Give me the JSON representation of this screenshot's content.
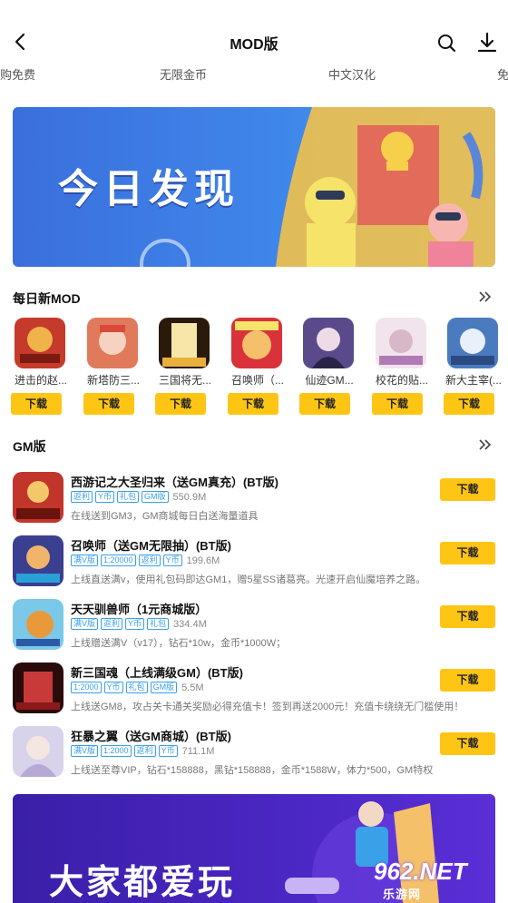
{
  "header": {
    "title": "MOD版"
  },
  "tabs": [
    "购免费",
    "无限金币",
    "中文汉化",
    "免"
  ],
  "hero_banner": {
    "text": "今日发现"
  },
  "daily_new": {
    "title": "每日新MOD",
    "apps": [
      {
        "name": "进击的赵...",
        "download_label": "下载",
        "color": "#c53a2a"
      },
      {
        "name": "新塔防三...",
        "download_label": "下载",
        "color": "#e07a5a"
      },
      {
        "name": "三国将无...",
        "download_label": "下载",
        "color": "#e9b03c"
      },
      {
        "name": "召唤师（...",
        "download_label": "下载",
        "color": "#d9323a"
      },
      {
        "name": "仙迹GM...",
        "download_label": "下载",
        "color": "#5a4a8c"
      },
      {
        "name": "校花的贴...",
        "download_label": "下载",
        "color": "#d8b7c9"
      },
      {
        "name": "新大主宰(...",
        "download_label": "下载",
        "color": "#4a7bbf"
      }
    ]
  },
  "gm_section": {
    "title": "GM版",
    "items": [
      {
        "name": "西游记之大圣归来（送GM真充）(BT版)",
        "tags": [
          "返利",
          "Y币",
          "礼包",
          "GM版"
        ],
        "size": "550.9M",
        "desc": "在线送到GM3，GM商城每日白送海量道具",
        "download_label": "下载",
        "color": "#c2352b"
      },
      {
        "name": "召唤师（送GM无限抽）(BT版)",
        "tags": [
          "满V版",
          "1:20000",
          "返利",
          "Y币"
        ],
        "size": "199.6M",
        "desc": "上线直送满v，使用礼包码即达GM1，赠5星SS诸葛亮。光速开启仙魔培养之路。",
        "download_label": "下载",
        "color": "#3a3f8f"
      },
      {
        "name": "天天驯兽师（1元商城版）",
        "tags": [
          "满V版",
          "返利",
          "Y币",
          "礼包"
        ],
        "size": "334.4M",
        "desc": "上线赠送满V（v17），钻石*10w，金币*1000W；",
        "download_label": "下载",
        "color": "#e89a3a"
      },
      {
        "name": "新三国魂（上线满级GM）(BT版)",
        "tags": [
          "1:2000",
          "Y币",
          "礼包",
          "GM版"
        ],
        "size": "5.5M",
        "desc": "上线送GM8，攻占关卡通关奖励必得充值卡！签到再送2000元！充值卡绕绕无门槛使用！",
        "download_label": "下载",
        "color": "#8a1a1a"
      },
      {
        "name": "狂暴之翼（送GM商城）(BT版)",
        "tags": [
          "满V版",
          "1:2000",
          "返利",
          "Y币"
        ],
        "size": "711.1M",
        "desc": "上线送至尊VIP，钻石*158888，黑钻*158888，金币*1588W，体力*500，GM特权",
        "download_label": "下载",
        "color": "#b7a9d6"
      }
    ]
  },
  "bottom_banner": {
    "text": "大家都爱玩"
  },
  "watermark": {
    "top": "962.NET",
    "bottom": "乐游网"
  },
  "colors": {
    "accent_yellow": "#ffc515",
    "tag_blue": "#3aa0e8"
  }
}
